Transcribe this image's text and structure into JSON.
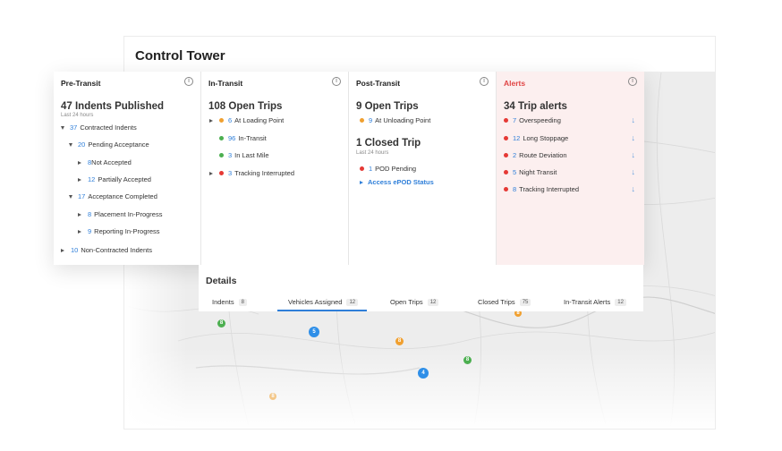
{
  "page_title": "Control Tower",
  "cards": {
    "pre_transit": {
      "title": "Pre-Transit",
      "headline": "47 Indents Published",
      "sub": "Last 24 hours",
      "rows": [
        {
          "num": "37",
          "label": "Contracted Indents"
        },
        {
          "num": "20",
          "label": "Pending Acceptance"
        },
        {
          "num": "8",
          "label": "Not Accepted"
        },
        {
          "num": "12",
          "label": "Partially Accepted"
        },
        {
          "num": "17",
          "label": "Acceptance Completed"
        },
        {
          "num": "8",
          "label": "Placement In-Progress"
        },
        {
          "num": "9",
          "label": "Reporting In-Progress"
        },
        {
          "num": "10",
          "label": "Non-Contracted Indents"
        }
      ]
    },
    "in_transit": {
      "title": "In-Transit",
      "headline": "108 Open Trips",
      "rows": [
        {
          "num": "6",
          "label": "At Loading Point",
          "color": "#f0a030"
        },
        {
          "num": "96",
          "label": "In-Transit",
          "color": "#4caf50"
        },
        {
          "num": "3",
          "label": "In Last Mile",
          "color": "#4caf50"
        },
        {
          "num": "3",
          "label": "Tracking Interrupted",
          "color": "#e53935"
        }
      ]
    },
    "post_transit": {
      "title": "Post-Transit",
      "headline": "9 Open Trips",
      "open_rows": [
        {
          "num": "9",
          "label": "At Unloading Point",
          "color": "#f0a030"
        }
      ],
      "headline2": "1 Closed Trip",
      "sub": "Last 24 hours",
      "closed_rows": [
        {
          "num": "1",
          "label": "POD Pending",
          "color": "#e53935"
        }
      ],
      "link": "Access ePOD Status"
    },
    "alerts": {
      "title": "Alerts",
      "headline": "34 Trip alerts",
      "rows": [
        {
          "num": "7",
          "label": "Overspeeding"
        },
        {
          "num": "12",
          "label": "Long Stoppage"
        },
        {
          "num": "2",
          "label": "Route Deviation"
        },
        {
          "num": "5",
          "label": "Night Transit"
        },
        {
          "num": "8",
          "label": "Tracking Interrupted"
        }
      ],
      "dot_color": "#e53935"
    }
  },
  "details": {
    "title": "Details",
    "tabs": [
      {
        "label": "Indents",
        "count": "8"
      },
      {
        "label": "Vehicles Assigned",
        "count": "12"
      },
      {
        "label": "Open Trips",
        "count": "12"
      },
      {
        "label": "Closed Trips",
        "count": "75"
      },
      {
        "label": "In-Transit Alerts",
        "count": "12"
      }
    ],
    "active_tab": "Vehicles Assigned"
  },
  "map_markers": [
    {
      "label": "8",
      "color": "#4caf50"
    },
    {
      "label": "5",
      "color": "#2f8fe8"
    },
    {
      "label": "8",
      "color": "#f0a030"
    },
    {
      "label": "4",
      "color": "#2f8fe8"
    },
    {
      "label": "8",
      "color": "#4caf50"
    },
    {
      "label": "8",
      "color": "#f0a030"
    },
    {
      "label": "8",
      "color": "#f0a030"
    }
  ]
}
